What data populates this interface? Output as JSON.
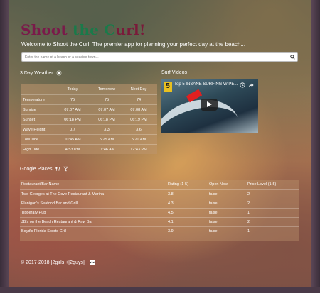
{
  "header": {
    "title_parts": [
      "S",
      "hoot ",
      "the ",
      "C",
      "url!"
    ],
    "title_colors": [
      "#7a1a4a",
      "#7a1a4a",
      "#1a7a4a",
      "#1a7a4a",
      "#7a1a3a"
    ],
    "tagline": "Welcome to Shoot the Curl! The premier app for planning your perfect day at the beach..."
  },
  "search": {
    "placeholder": "Enter the name of a beach or a seaside town..."
  },
  "weather": {
    "heading": "3 Day Weather",
    "columns": [
      "Today",
      "Tomorrow",
      "Next Day"
    ],
    "rows": [
      {
        "label": "Temperature",
        "values": [
          "75",
          "75",
          "74"
        ]
      },
      {
        "label": "Sunrise",
        "values": [
          "07:07 AM",
          "07:07 AM",
          "07:08 AM"
        ]
      },
      {
        "label": "Sunset",
        "values": [
          "06:18 PM",
          "06:18 PM",
          "06:19 PM"
        ]
      },
      {
        "label": "Wave Height",
        "values": [
          "0.7",
          "3.3",
          "3.6"
        ]
      },
      {
        "label": "Low Tide",
        "values": [
          "10:45 AM",
          "5:25 AM",
          "5:20 AM"
        ]
      },
      {
        "label": "High Tide",
        "values": [
          "4:53 PM",
          "11:46 AM",
          "12:43 PM"
        ]
      }
    ]
  },
  "video": {
    "heading": "Surf Videos",
    "title": "Top 5 INSANE SURFING WIPE...",
    "badge": "5"
  },
  "places": {
    "heading": "Google Places",
    "columns": [
      "Restaurant/Bar Name",
      "Rating (1-5)",
      "Open Now",
      "Price Level (1-5)"
    ],
    "rows": [
      {
        "name": "Two Georges at The Cove Restaurant & Marina",
        "rating": "3.8",
        "open": "false",
        "price": "2"
      },
      {
        "name": "Flanigan's Seafood Bar and Grill",
        "rating": "4.3",
        "open": "false",
        "price": "2"
      },
      {
        "name": "Tipperary Pub",
        "rating": "4.5",
        "open": "false",
        "price": "1"
      },
      {
        "name": "JB's on the Beach Restaurant & Raw Bar",
        "rating": "4.1",
        "open": "false",
        "price": "2"
      },
      {
        "name": "Boyd's Florida Sports Grill",
        "rating": "3.9",
        "open": "false",
        "price": "1"
      }
    ]
  },
  "footer": {
    "text": "© 2017-2018 [2girls]+[2guys]"
  }
}
